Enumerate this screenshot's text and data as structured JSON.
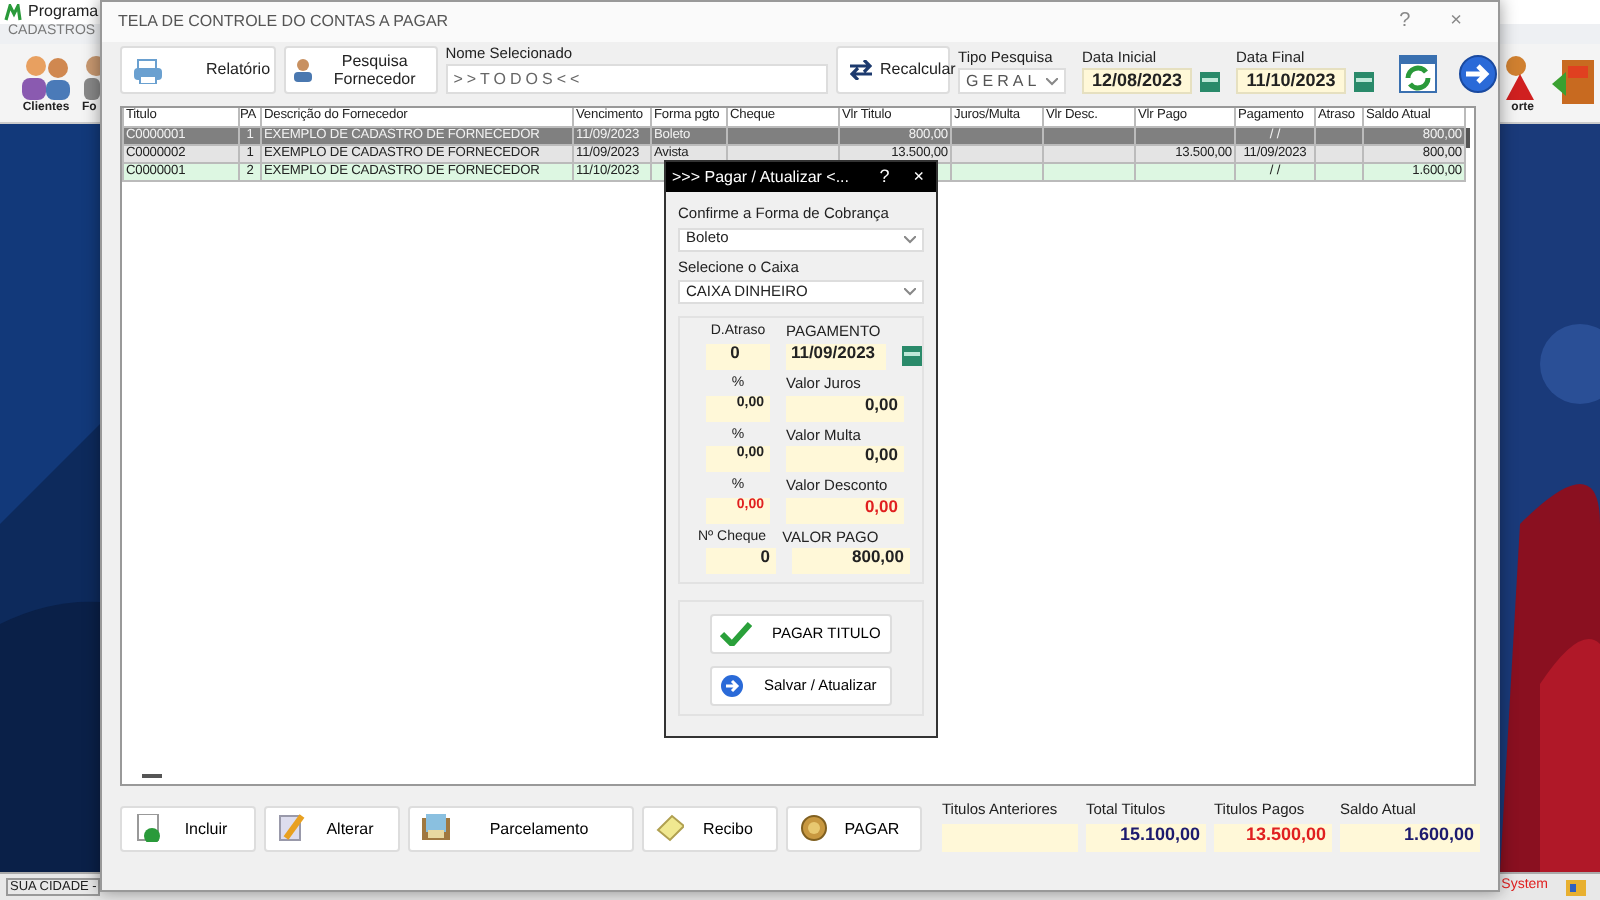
{
  "app": {
    "title": "Programa",
    "menu": [
      "CADASTROS"
    ],
    "toolbar_left": [
      "Clientes",
      "Fo"
    ],
    "toolbar_right": [
      "orte"
    ],
    "status_left": "SUA CIDADE - ",
    "status_right": "System"
  },
  "window": {
    "title": "TELA DE CONTROLE DO CONTAS A PAGAR",
    "help": "?",
    "close": "×",
    "report_button": "Relatório",
    "supplier_search_button": "Pesquisa Fornecedor",
    "selected_name": {
      "label": "Nome Selecionado",
      "value": ">>TODOS<<"
    },
    "recalc_button": "Recalcular",
    "search_type": {
      "label": "Tipo  Pesquisa",
      "value": "GERAL"
    },
    "start_date": {
      "label": "Data Inicial",
      "value": "12/08/2023"
    },
    "end_date": {
      "label": "Data Final",
      "value": "11/10/2023"
    }
  },
  "table": {
    "columns": [
      "Titulo",
      "PA",
      "Descrição do Fornecedor",
      "Vencimento",
      "Forma pgto",
      "Cheque",
      "Vlr Titulo",
      "Juros/Multa",
      "Vlr Desc.",
      "Vlr Pago",
      "Pagamento",
      "Atraso",
      "Saldo Atual"
    ],
    "rows": [
      {
        "selected": true,
        "color": "#808080",
        "cells": [
          "C0000001",
          "1",
          "EXEMPLO DE CADASTRO DE FORNECEDOR",
          "11/09/2023",
          "Boleto",
          "",
          "800,00",
          "",
          "",
          "",
          "/ /",
          "",
          "800,00"
        ]
      },
      {
        "selected": false,
        "color": "#e4e4e4",
        "cells": [
          "C0000002",
          "1",
          "EXEMPLO DE CADASTRO DE FORNECEDOR",
          "11/09/2023",
          "Avista",
          "",
          "13.500,00",
          "",
          "",
          "13.500,00",
          "11/09/2023",
          "",
          "800,00"
        ]
      },
      {
        "selected": false,
        "color": "#ddf7e2",
        "cells": [
          "C0000001",
          "2",
          "EXEMPLO DE CADASTRO DE FORNECEDOR",
          "11/10/2023",
          "",
          "",
          "",
          "",
          "",
          "",
          "/ /",
          "",
          "1.600,00"
        ]
      }
    ]
  },
  "actions": [
    "Incluir",
    "Alterar",
    "Parcelamento",
    "Recibo",
    "PAGAR"
  ],
  "totals": [
    {
      "label": "Titulos Anteriores",
      "kind": "plain"
    },
    {
      "label": "Total Titulos",
      "value": "15.100,00",
      "kind": "total"
    },
    {
      "label": "Titulos Pagos",
      "value": "13.500,00",
      "kind": "paid"
    },
    {
      "label": "Saldo Atual",
      "value": "1.600,00",
      "kind": "total"
    }
  ],
  "payment_dialog": {
    "title": ">>> Pagar / Atualizar <...",
    "help": "?",
    "close": "×",
    "charge": {
      "label": "Confirme a Forma de Cobrança",
      "value": "Boleto"
    },
    "cashbox": {
      "label": "Selecione o Caixa",
      "value": "CAIXA DINHEIRO"
    },
    "rows": [
      {
        "kind": "date",
        "left_label": "D.Atraso",
        "left_value": "0",
        "right_label": "PAGAMENTO",
        "right_value": "11/09/2023"
      },
      {
        "kind": "amount",
        "left_label": "%",
        "left_value": "0,00",
        "right_label": "Valor Juros",
        "right_value": "0,00"
      },
      {
        "kind": "amount",
        "left_label": "%",
        "left_value": "0,00",
        "right_label": "Valor Multa",
        "right_value": "0,00"
      },
      {
        "kind": "discount",
        "left_label": "%",
        "left_value": "0,00",
        "right_label": "Valor Desconto",
        "right_value": "0,00"
      },
      {
        "kind": "total",
        "left_label": "Nº Cheque",
        "left_value": "0",
        "right_label": "VALOR PAGO",
        "right_value": "800,00"
      }
    ],
    "buttons": [
      "PAGAR TITULO",
      "Salvar / Atualizar"
    ]
  }
}
